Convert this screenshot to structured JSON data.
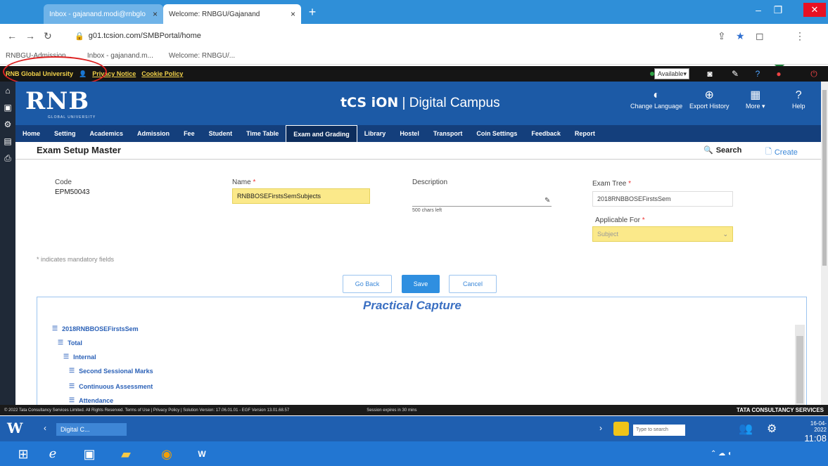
{
  "browser": {
    "tabs": [
      {
        "label": "Inbox - gajanand.modi@rnbglo",
        "close": "×"
      },
      {
        "label": "Welcome: RNBGU/Gajanand",
        "close": "×"
      }
    ],
    "new_tab": "+",
    "url": "g01.tcsion.com/SMBPortal/home",
    "bookmarks": [
      "RNBGU-Admission...",
      "Inbox - gajanand.m...",
      "Welcome: RNBGU/..."
    ]
  },
  "topbar": {
    "university": "RNB Global University",
    "links": [
      "Privacy Notice",
      "Cookie Policy"
    ],
    "status": "Available"
  },
  "header": {
    "logo": "RNB",
    "logo_sub": "GLOBAL UNIVERSITY",
    "brand_prefix": "tCS iON",
    "brand_suffix": " | Digital Campus",
    "buttons": [
      "Change Language",
      "Export History",
      "More ▾",
      "Help"
    ]
  },
  "menu": {
    "items": [
      "Home",
      "Setting",
      "Academics",
      "Admission",
      "Fee",
      "Student",
      "Time Table",
      "Exam and Grading",
      "Library",
      "Hostel",
      "Transport",
      "Coin Settings",
      "Feedback",
      "Report"
    ],
    "active_index": 7
  },
  "page": {
    "title": "Exam Setup Master",
    "search": "Search",
    "create": "Create"
  },
  "form": {
    "code_label": "Code",
    "code_value": "EPM50043",
    "name_label": "Name",
    "name_value": "RNBBOSEFirstsSemSubjects",
    "description_label": "Description",
    "description_count": "500 chars left",
    "examtree_label": "Exam Tree",
    "examtree_value": "2018RNBBOSEFirstsSem",
    "applicable_label": "Applicable For",
    "applicable_value": "Subject",
    "mandatory_note": "* indicates mandatory fields",
    "required_mark": "*",
    "buttons": {
      "goback": "Go Back",
      "save": "Save",
      "cancel": "Cancel"
    }
  },
  "practical": {
    "title": "Practical Capture",
    "tree": [
      "2018RNBBOSEFirstsSem",
      "Total",
      "Internal",
      "Second Sessional Marks",
      "Continuous Assessment",
      "Attendance"
    ]
  },
  "footer": {
    "left": "© 2022 Tata Consultancy Services Limited. All Rights Reserved.   Terms of Use | Privacy Policy | Solution Version: 17.06.01.01 - EGF Version 13.01.68.57",
    "session": "Session expires in 30 mins",
    "brand": "TATA CONSULTANCY SERVICES"
  },
  "taskbar": {
    "app_tab": "Digital C...",
    "search_placeholder": "Type to search",
    "time": "11:08 AM",
    "date": "16-04-2022"
  }
}
